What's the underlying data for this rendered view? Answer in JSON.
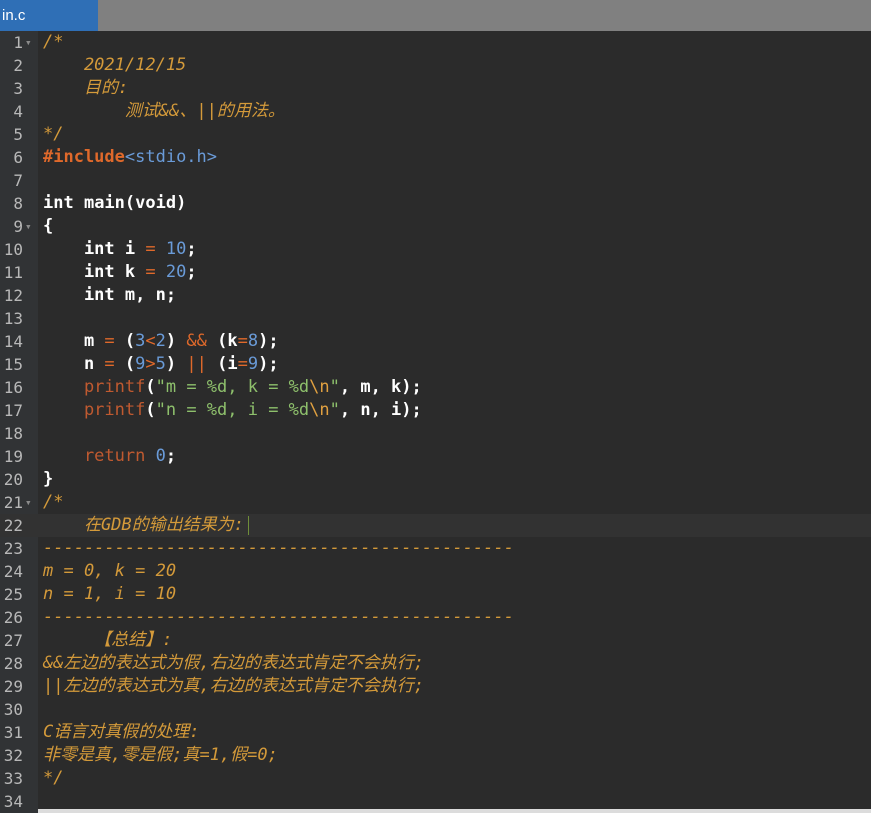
{
  "tab": {
    "title": "in.c"
  },
  "lines": [
    {
      "n": "1",
      "fold": "-",
      "tokens": [
        [
          "c-com",
          "/*"
        ]
      ]
    },
    {
      "n": "2",
      "tokens": [
        [
          "c-com",
          "    2021/12/15"
        ]
      ]
    },
    {
      "n": "3",
      "tokens": [
        [
          "c-com",
          "    目的:"
        ]
      ]
    },
    {
      "n": "4",
      "tokens": [
        [
          "c-com",
          "        测试&&、||的用法。"
        ]
      ]
    },
    {
      "n": "5",
      "tokens": [
        [
          "c-com",
          "*/"
        ]
      ]
    },
    {
      "n": "6",
      "tokens": [
        [
          "c-pre",
          "#include"
        ],
        [
          "c-hdr",
          "<stdio.h>"
        ]
      ]
    },
    {
      "n": "7",
      "tokens": []
    },
    {
      "n": "8",
      "tokens": [
        [
          "c-kw",
          "int"
        ],
        [
          "c-id",
          " main(void)"
        ]
      ]
    },
    {
      "n": "9",
      "fold": "-",
      "tokens": [
        [
          "c-id",
          "{"
        ]
      ]
    },
    {
      "n": "10",
      "tokens": [
        [
          "c-kw",
          "    int"
        ],
        [
          "c-id",
          " i "
        ],
        [
          "c-op",
          "="
        ],
        [
          "c-id",
          " "
        ],
        [
          "c-num",
          "10"
        ],
        [
          "c-id",
          ";"
        ]
      ]
    },
    {
      "n": "11",
      "tokens": [
        [
          "c-kw",
          "    int"
        ],
        [
          "c-id",
          " k "
        ],
        [
          "c-op",
          "="
        ],
        [
          "c-id",
          " "
        ],
        [
          "c-num",
          "20"
        ],
        [
          "c-id",
          ";"
        ]
      ]
    },
    {
      "n": "12",
      "tokens": [
        [
          "c-kw",
          "    int"
        ],
        [
          "c-id",
          " m, n;"
        ]
      ]
    },
    {
      "n": "13",
      "tokens": []
    },
    {
      "n": "14",
      "tokens": [
        [
          "c-id",
          "    m "
        ],
        [
          "c-op",
          "="
        ],
        [
          "c-id",
          " ("
        ],
        [
          "c-num",
          "3"
        ],
        [
          "c-op",
          "<"
        ],
        [
          "c-num",
          "2"
        ],
        [
          "c-id",
          ") "
        ],
        [
          "c-op",
          "&&"
        ],
        [
          "c-id",
          " (k"
        ],
        [
          "c-op",
          "="
        ],
        [
          "c-num",
          "8"
        ],
        [
          "c-id",
          ");"
        ]
      ]
    },
    {
      "n": "15",
      "tokens": [
        [
          "c-id",
          "    n "
        ],
        [
          "c-op",
          "="
        ],
        [
          "c-id",
          " ("
        ],
        [
          "c-num",
          "9"
        ],
        [
          "c-op",
          ">"
        ],
        [
          "c-num",
          "5"
        ],
        [
          "c-id",
          ") "
        ],
        [
          "c-op",
          "||"
        ],
        [
          "c-id",
          " (i"
        ],
        [
          "c-op",
          "="
        ],
        [
          "c-num",
          "9"
        ],
        [
          "c-id",
          ");"
        ]
      ]
    },
    {
      "n": "16",
      "tokens": [
        [
          "c-fn",
          "    printf"
        ],
        [
          "c-id",
          "("
        ],
        [
          "c-str",
          "\"m = %d, k = %d"
        ],
        [
          "c-esc",
          "\\n"
        ],
        [
          "c-str",
          "\""
        ],
        [
          "c-id",
          ", m, k);"
        ]
      ]
    },
    {
      "n": "17",
      "tokens": [
        [
          "c-fn",
          "    printf"
        ],
        [
          "c-id",
          "("
        ],
        [
          "c-str",
          "\"n = %d, i = %d"
        ],
        [
          "c-esc",
          "\\n"
        ],
        [
          "c-str",
          "\""
        ],
        [
          "c-id",
          ", n, i);"
        ]
      ]
    },
    {
      "n": "18",
      "tokens": []
    },
    {
      "n": "19",
      "tokens": [
        [
          "c-fn",
          "    return"
        ],
        [
          "c-id",
          " "
        ],
        [
          "c-num",
          "0"
        ],
        [
          "c-id",
          ";"
        ]
      ]
    },
    {
      "n": "20",
      "tokens": [
        [
          "c-id",
          "}"
        ]
      ]
    },
    {
      "n": "21",
      "fold": "-",
      "tokens": [
        [
          "c-com",
          "/*"
        ]
      ]
    },
    {
      "n": "22",
      "current": true,
      "caret": true,
      "tokens": [
        [
          "c-com",
          "    在GDB的输出结果为:"
        ]
      ]
    },
    {
      "n": "23",
      "tokens": [
        [
          "c-com",
          "----------------------------------------------"
        ]
      ]
    },
    {
      "n": "24",
      "tokens": [
        [
          "c-com",
          "m = 0, k = 20"
        ]
      ]
    },
    {
      "n": "25",
      "tokens": [
        [
          "c-com",
          "n = 1, i = 10"
        ]
      ]
    },
    {
      "n": "26",
      "tokens": [
        [
          "c-com",
          "----------------------------------------------"
        ]
      ]
    },
    {
      "n": "27",
      "tokens": [
        [
          "c-com",
          "     【总结】:"
        ]
      ]
    },
    {
      "n": "28",
      "tokens": [
        [
          "c-com",
          "&&左边的表达式为假,右边的表达式肯定不会执行;"
        ]
      ]
    },
    {
      "n": "29",
      "tokens": [
        [
          "c-com",
          "||左边的表达式为真,右边的表达式肯定不会执行;"
        ]
      ]
    },
    {
      "n": "30",
      "tokens": []
    },
    {
      "n": "31",
      "tokens": [
        [
          "c-com",
          "C语言对真假的处理:"
        ]
      ]
    },
    {
      "n": "32",
      "tokens": [
        [
          "c-com",
          "非零是真,零是假;真=1,假=0;"
        ]
      ]
    },
    {
      "n": "33",
      "tokens": [
        [
          "c-com",
          "*/"
        ]
      ]
    },
    {
      "n": "34",
      "tokens": []
    }
  ]
}
